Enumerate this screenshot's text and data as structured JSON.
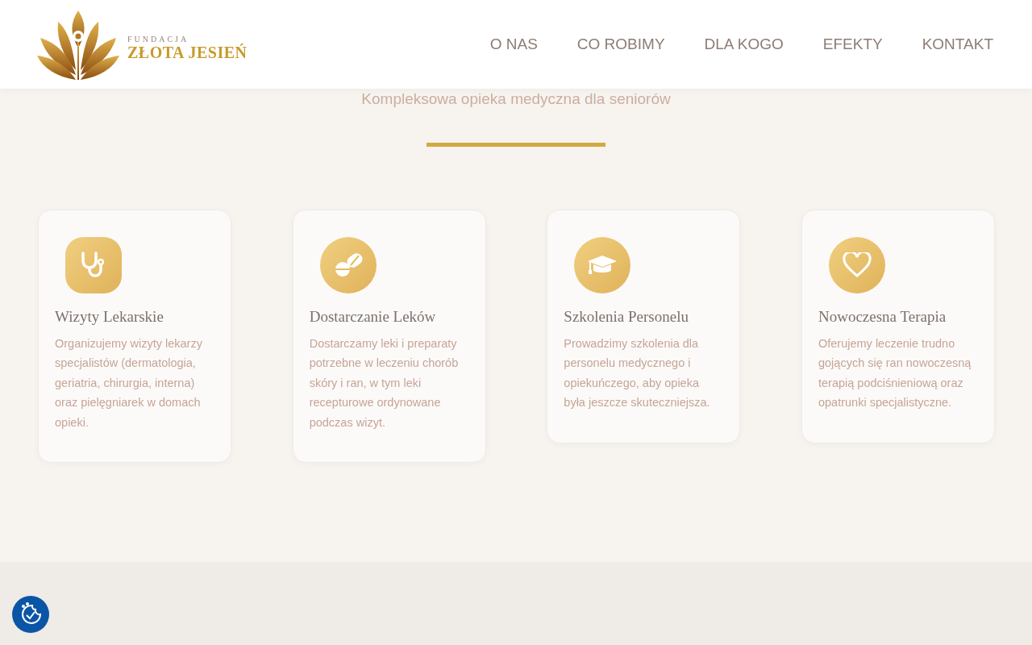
{
  "header": {
    "logo": {
      "small": "FUNDACJA",
      "name": "ZŁOTA JESIEŃ"
    },
    "nav": [
      {
        "label": "O NAS"
      },
      {
        "label": "CO ROBIMY"
      },
      {
        "label": "DLA KOGO"
      },
      {
        "label": "EFEKTY"
      },
      {
        "label": "KONTAKT"
      }
    ]
  },
  "section": {
    "subtitle": "Kompleksowa opieka medyczna dla seniorów",
    "cards": [
      {
        "title": "Wizyty Lekarskie",
        "text": "Organizujemy wizyty lekarzy specjalistów (dermatologia, geriatria, chirurgia, interna) oraz pielęgniarek w domach opieki."
      },
      {
        "title": "Dostarczanie Leków",
        "text": "Dostarczamy leki i preparaty potrzebne w leczeniu chorób skóry i ran, w tym leki recepturowe ordynowane podczas wizyt."
      },
      {
        "title": "Szkolenia Personelu",
        "text": "Prowadzimy szkolenia dla personelu medycznego i opiekuńczego, aby opieka była jeszcze skuteczniejsza."
      },
      {
        "title": "Nowoczesna Terapia",
        "text": "Oferujemy leczenie trudno gojących się ran nowoczesną terapią podciśnieniową oraz opatrunki specjalistyczne."
      }
    ]
  }
}
